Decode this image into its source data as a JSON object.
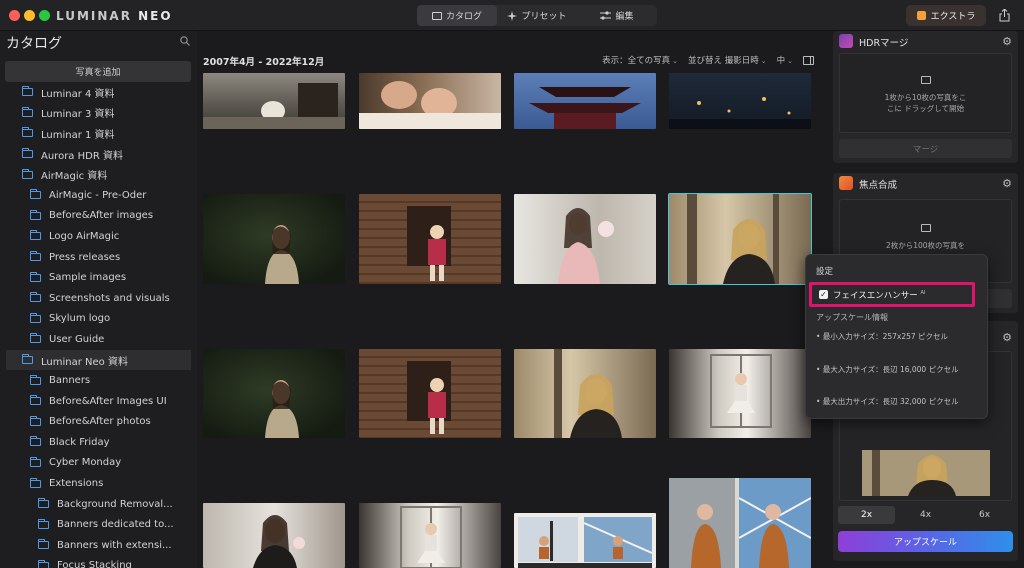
{
  "app": {
    "logo_text": "LUMINAR",
    "logo_neo": "NEO"
  },
  "modes": [
    {
      "label": "カタログ",
      "icon": "folder-icon",
      "active": true
    },
    {
      "label": "プリセット",
      "icon": "sparkle-icon",
      "active": false
    },
    {
      "label": "編集",
      "icon": "sliders-icon",
      "active": false
    }
  ],
  "header": {
    "extra_label": "エクストラ"
  },
  "sidebar": {
    "title": "カタログ",
    "add_photo_label": "写真を追加",
    "folders": [
      {
        "label": "Luminar 4 資料",
        "level": 0
      },
      {
        "label": "Luminar 3 資料",
        "level": 0
      },
      {
        "label": "Luminar 1 資料",
        "level": 0
      },
      {
        "label": "Aurora HDR 資料",
        "level": 0
      },
      {
        "label": "AirMagic 資料",
        "level": 0
      },
      {
        "label": "AirMagic - Pre-Oder",
        "level": 1
      },
      {
        "label": "Before&After images",
        "level": 1
      },
      {
        "label": "Logo AirMagic",
        "level": 1
      },
      {
        "label": "Press releases",
        "level": 1
      },
      {
        "label": "Sample images",
        "level": 1
      },
      {
        "label": "Screenshots and visuals",
        "level": 1
      },
      {
        "label": "Skylum logo",
        "level": 1
      },
      {
        "label": "User Guide",
        "level": 1
      },
      {
        "label": "Luminar Neo 資料",
        "level": 0,
        "selected": true
      },
      {
        "label": "Banners",
        "level": 1
      },
      {
        "label": "Before&After Images UI",
        "level": 1
      },
      {
        "label": "Before&After photos",
        "level": 1
      },
      {
        "label": "Black Friday",
        "level": 1
      },
      {
        "label": "Cyber Monday",
        "level": 1
      },
      {
        "label": "Extensions",
        "level": 1
      },
      {
        "label": "Background Removal...",
        "level": 2
      },
      {
        "label": "Banners dedicated to...",
        "level": 2
      },
      {
        "label": "Banners with extensi...",
        "level": 2
      },
      {
        "label": "Focus Stacking",
        "level": 2
      }
    ]
  },
  "main": {
    "date_range": "2007年4月 - 2022年12月",
    "view_label": "表示：全ての写真",
    "sort_label": "並び替え 撮影日時",
    "size_label": "中"
  },
  "panel": {
    "hdr": {
      "title": "HDRマージ",
      "drop_text_1": "1枚から10枚の写真をこ",
      "drop_text_2": "こに ドラッグして開始",
      "merge_label": "マージ"
    },
    "focus": {
      "title": "焦点合成",
      "drop_text_1": "2枚から100枚の写真を"
    },
    "scales": [
      "2x",
      "4x",
      "6x"
    ],
    "upscale_label": "アップスケール"
  },
  "popover": {
    "title": "設定",
    "checkbox_label": "フェイスエンハンサー",
    "checkbox_sup": "AI",
    "checked": true,
    "subtitle": "アップスケール情報",
    "items": [
      "• 最小入力サイズ：257x257 ピクセル",
      "• 最大入力サイズ：長辺 16,000 ピクセル",
      "• 最大出力サイズ：長辺 32,000 ピクセル"
    ]
  },
  "colors": {
    "accent_selection": "#3fc9d9",
    "highlight_box": "#e2136c",
    "folder_blue": "#4d9ae8"
  }
}
